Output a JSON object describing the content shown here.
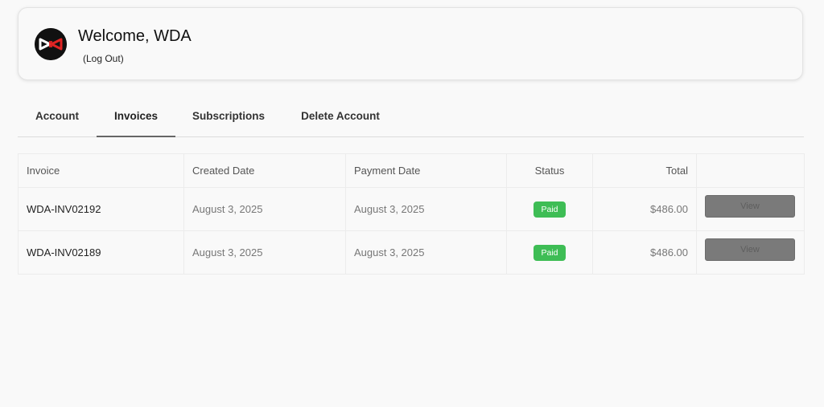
{
  "header": {
    "welcome": "Welcome, WDA",
    "logout": "(Log Out)",
    "avatar_icon": "brand-logo-icon"
  },
  "tabs": [
    {
      "label": "Account",
      "active": false
    },
    {
      "label": "Invoices",
      "active": true
    },
    {
      "label": "Subscriptions",
      "active": false
    },
    {
      "label": "Delete Account",
      "active": false
    }
  ],
  "table": {
    "columns": [
      "Invoice",
      "Created Date",
      "Payment Date",
      "Status",
      "Total",
      ""
    ],
    "rows": [
      {
        "invoice": "WDA-INV02192",
        "created": "August 3, 2025",
        "paid": "August 3, 2025",
        "status": "Paid",
        "total": "$486.00",
        "action": "View"
      },
      {
        "invoice": "WDA-INV02189",
        "created": "August 3, 2025",
        "paid": "August 3, 2025",
        "status": "Paid",
        "total": "$486.00",
        "action": "View"
      }
    ]
  },
  "colors": {
    "paid_badge": "#3ebd55",
    "view_button": "#7a7a7a",
    "logo_accent": "#e02424"
  }
}
